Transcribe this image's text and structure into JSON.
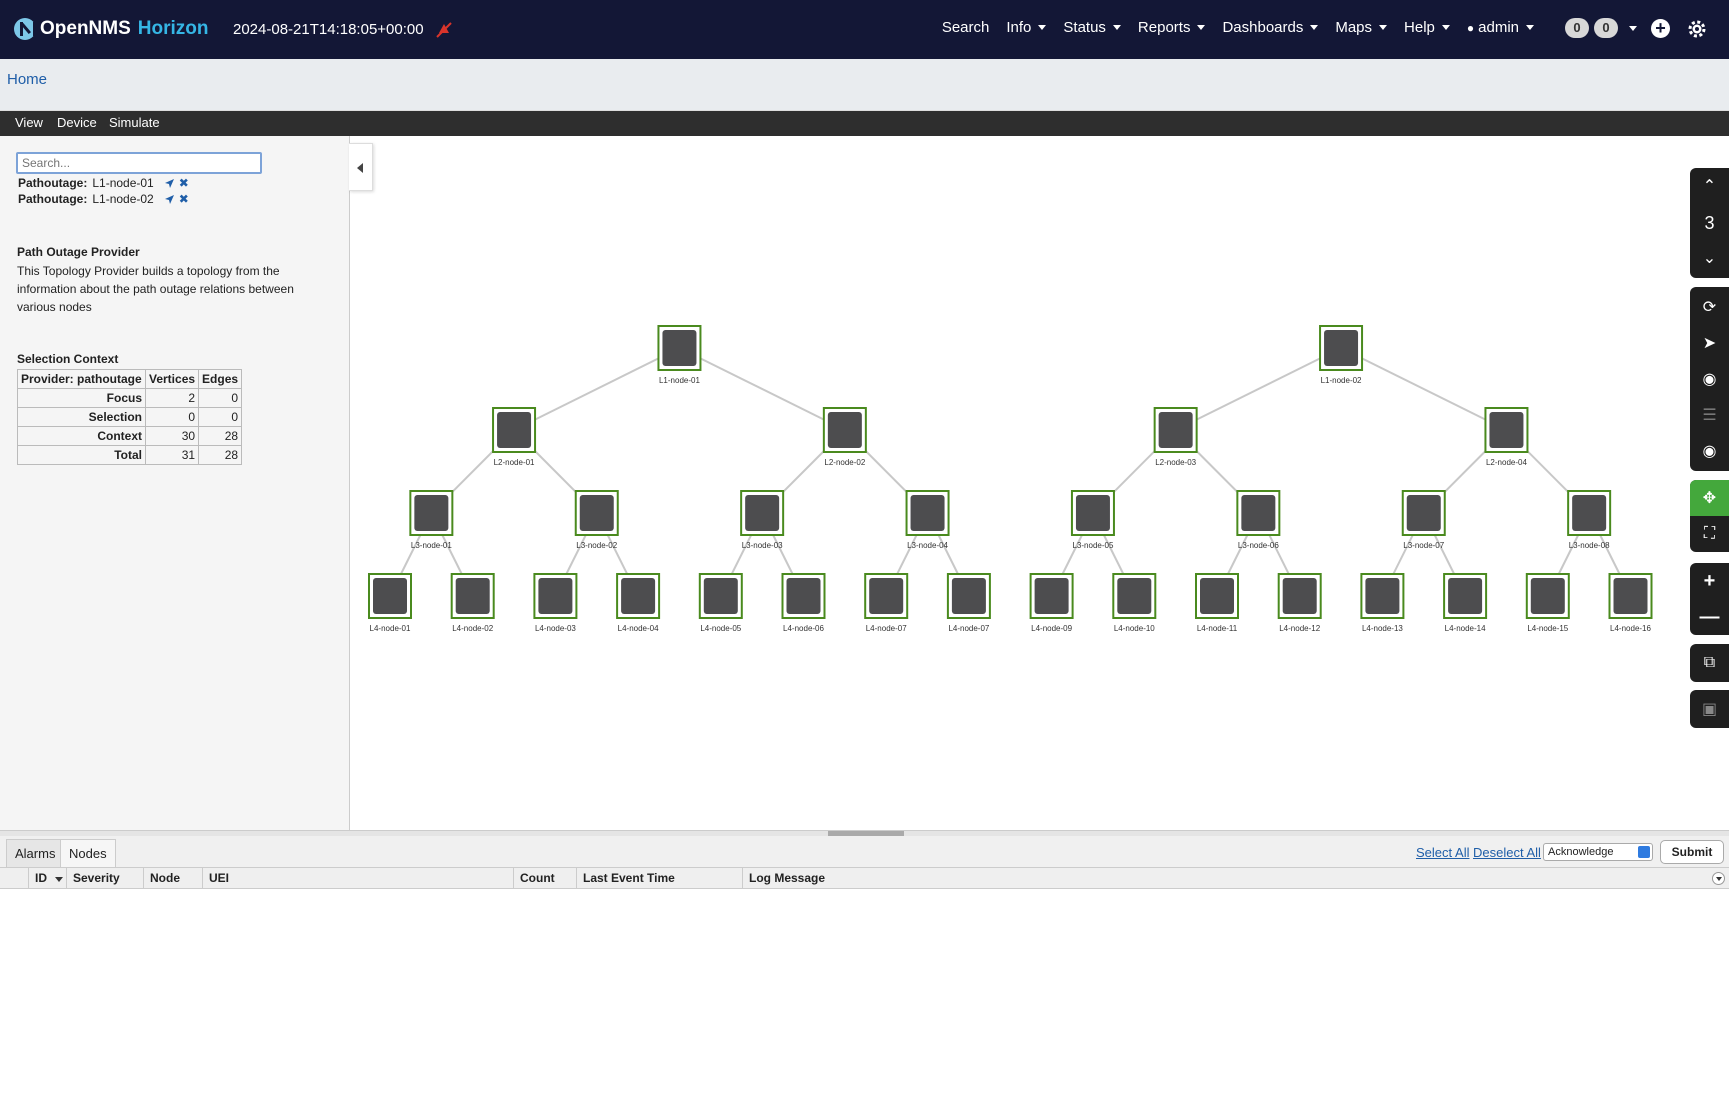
{
  "navbar": {
    "brand_main": "OpenNMS",
    "brand_sub": "Horizon",
    "timestamp": "2024-08-21T14:18:05+00:00",
    "menu": [
      "Search",
      "Info",
      "Status",
      "Reports",
      "Dashboards",
      "Maps",
      "Help",
      "admin"
    ],
    "badge_1": "0",
    "badge_2": "0"
  },
  "breadcrumb": {
    "home": "Home"
  },
  "toolbar": {
    "view": "View",
    "device": "Device",
    "simulate": "Simulate"
  },
  "sidebar": {
    "search_placeholder": "Search...",
    "pathoutage_label": "Pathoutage:",
    "pathoutage_items": [
      "L1-node-01",
      "L1-node-02"
    ],
    "provider_title": "Path Outage Provider",
    "provider_desc": "This Topology Provider builds a topology from the information about the path outage relations between various nodes",
    "selection_title": "Selection Context",
    "table": {
      "headers": [
        "Provider: pathoutage",
        "Vertices",
        "Edges"
      ],
      "rows": [
        {
          "label": "Focus",
          "vertices": "2",
          "edges": "0"
        },
        {
          "label": "Selection",
          "vertices": "0",
          "edges": "0"
        },
        {
          "label": "Context",
          "vertices": "30",
          "edges": "28"
        },
        {
          "label": "Total",
          "vertices": "31",
          "edges": "28"
        }
      ]
    }
  },
  "graph": {
    "semantic_zoom_level": "3",
    "node_border_color": "#4a8a1e",
    "node_fill_color": "#4d4d4f",
    "edge_color": "#c8c8c8",
    "l1": [
      "L1-node-01",
      "L1-node-02"
    ],
    "l2": [
      "L2-node-01",
      "L2-node-02",
      "L2-node-03",
      "L2-node-04"
    ],
    "l3": [
      "L3-node-01",
      "L3-node-02",
      "L3-node-03",
      "L3-node-04",
      "L3-node-05",
      "L3-node-06",
      "L3-node-07",
      "L3-node-08"
    ],
    "l4": [
      "L4-node-01",
      "L4-node-02",
      "L4-node-03",
      "L4-node-04",
      "L4-node-05",
      "L4-node-06",
      "L4-node-07",
      "L4-node-07",
      "L4-node-09",
      "L4-node-10",
      "L4-node-11",
      "L4-node-12",
      "L4-node-13",
      "L4-node-14",
      "L4-node-15",
      "L4-node-16"
    ]
  },
  "bottom": {
    "tabs": [
      "Alarms",
      "Nodes"
    ],
    "select_all": "Select All",
    "deselect_all": "Deselect All",
    "action_select": "Acknowledge",
    "submit": "Submit",
    "columns": [
      "ID",
      "Severity",
      "Node",
      "UEI",
      "Count",
      "Last Event Time",
      "Log Message"
    ]
  }
}
